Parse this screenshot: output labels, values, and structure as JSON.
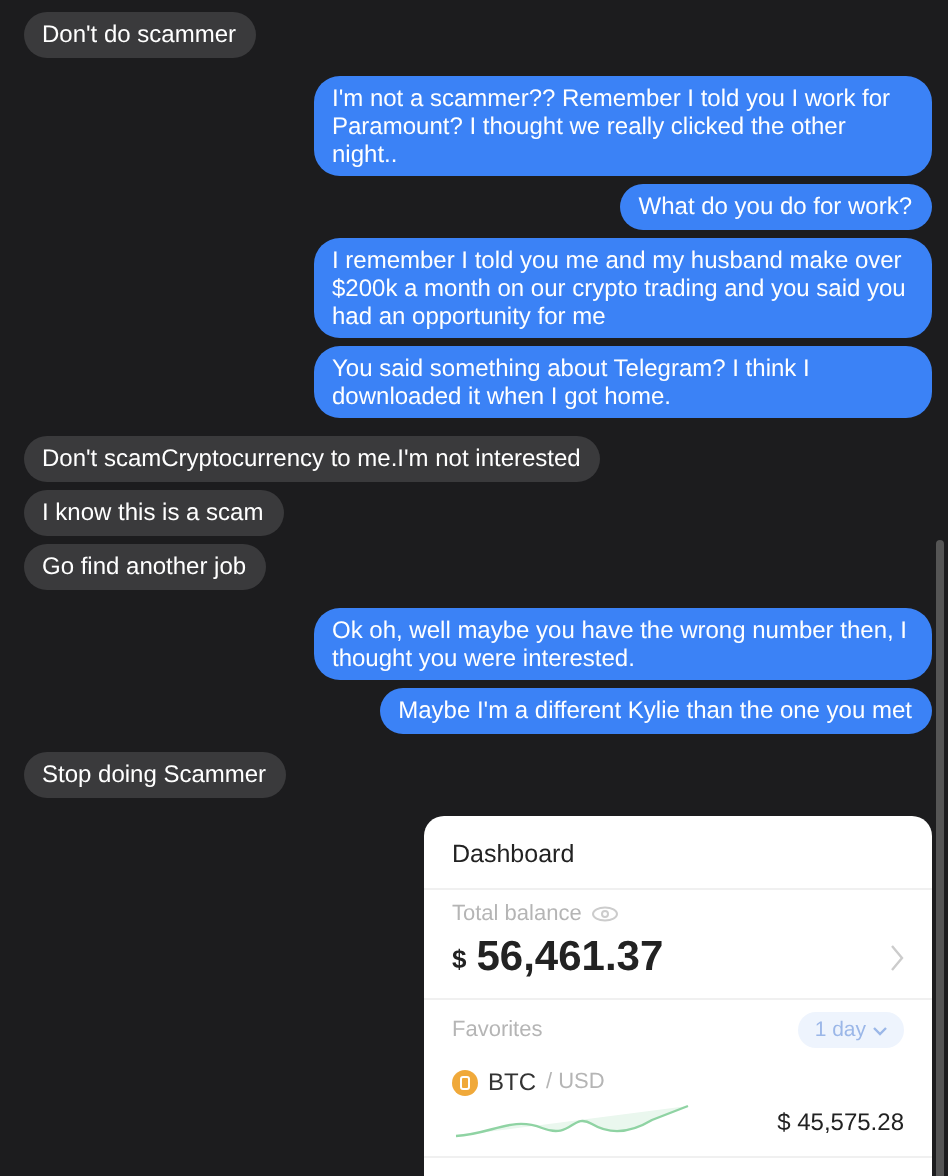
{
  "groups": [
    {
      "kind": "received",
      "messages": [
        "Don't do scammer"
      ]
    },
    {
      "kind": "sent",
      "messages": [
        "I'm not a scammer?? Remember I told you I work for Paramount? I thought we really clicked the other night..",
        "What do you do for work?",
        "I remember I told you me and my husband make over $200k a month on our crypto trading and you said you had an opportunity for me",
        "You said something about Telegram? I think I downloaded it when I got home."
      ]
    },
    {
      "kind": "received",
      "messages": [
        "Don't scamCryptocurrency to me.I'm not interested",
        "I know this is a scam",
        "Go find another job"
      ]
    },
    {
      "kind": "sent",
      "messages": [
        "Ok oh, well maybe you have the wrong number then, I thought you were interested.",
        "Maybe I'm a different Kylie than the one you met"
      ]
    },
    {
      "kind": "received",
      "messages": [
        "Stop doing Scammer"
      ]
    }
  ],
  "attachment": {
    "title": "Dashboard",
    "balance_label": "Total balance",
    "currency": "$",
    "balance": "56,461.37",
    "favorites_label": "Favorites",
    "period": "1 day",
    "coin": "BTC",
    "pair": "/ USD",
    "price": "$ 45,575.28"
  }
}
